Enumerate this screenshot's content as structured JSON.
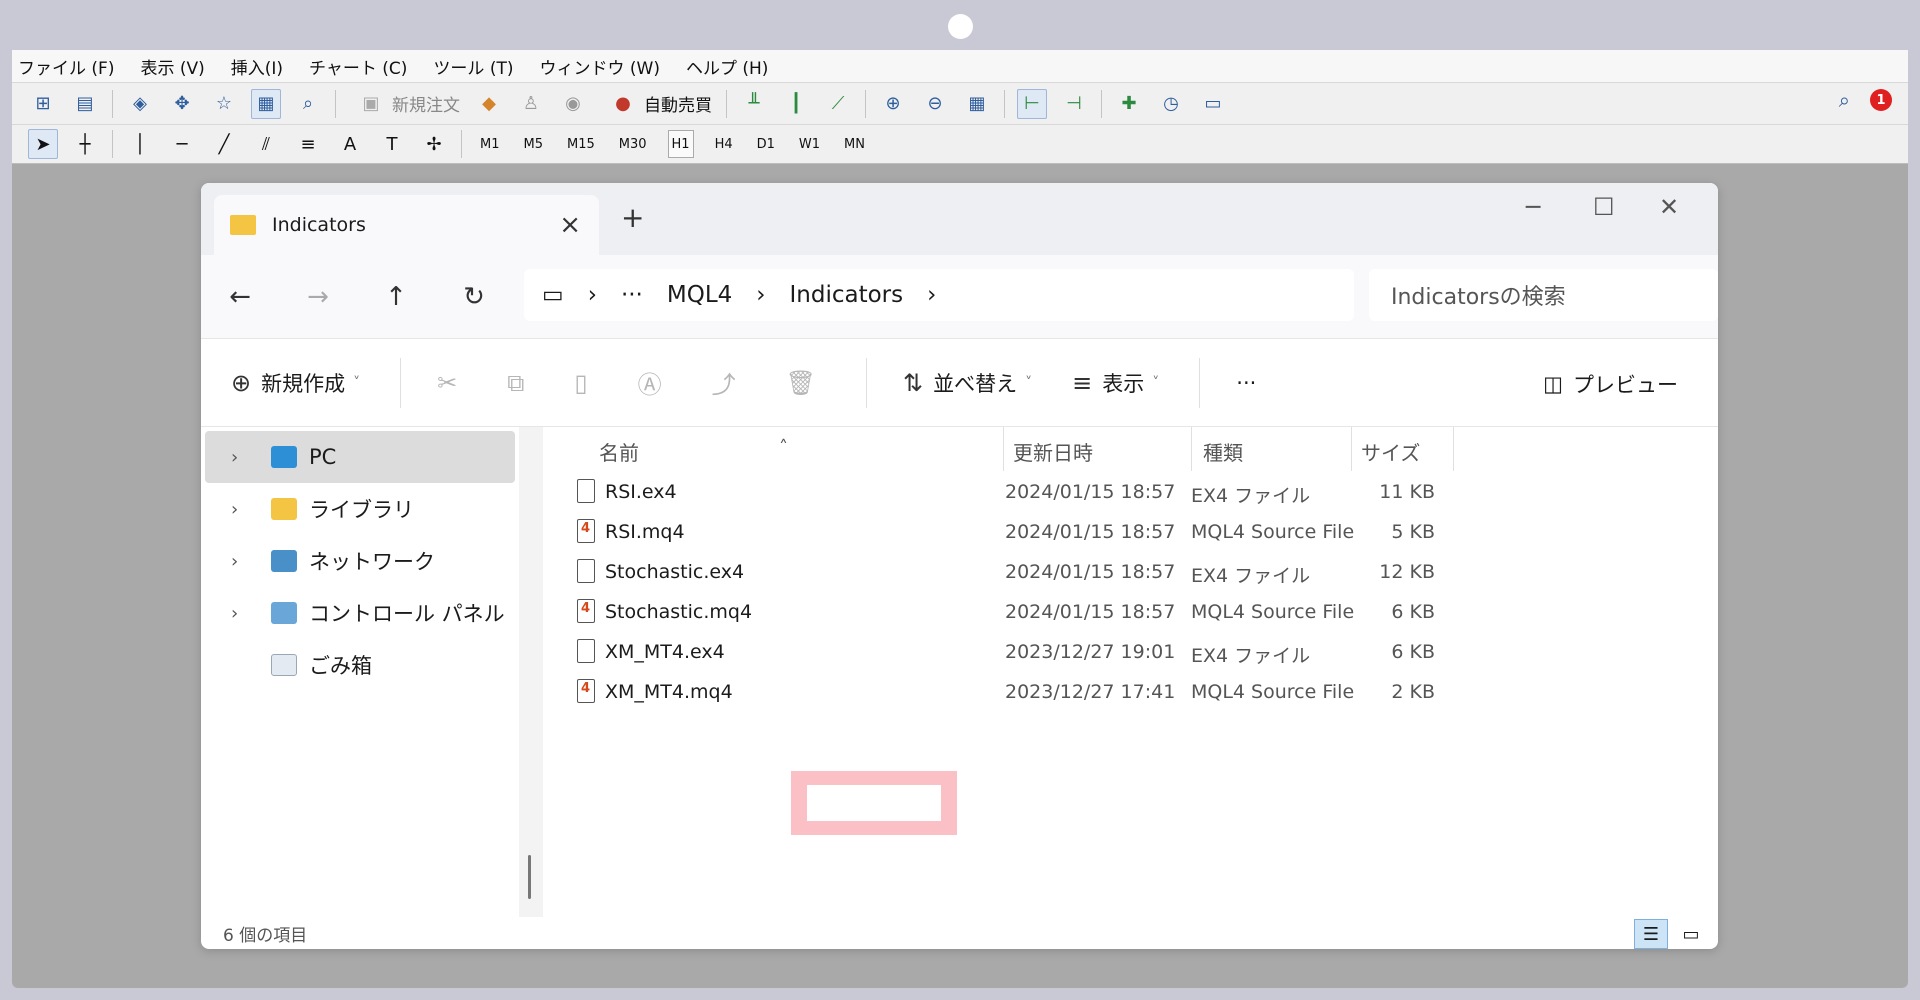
{
  "mt4": {
    "menu": [
      "ファイル (F)",
      "表示 (V)",
      "挿入(I)",
      "チャート (C)",
      "ツール (T)",
      "ウィンドウ (W)",
      "ヘルプ (H)"
    ],
    "new_order_label": "新規注文",
    "auto_trade_label": "自動売買",
    "timeframes": [
      "M1",
      "M5",
      "M15",
      "M30",
      "H1",
      "H4",
      "D1",
      "W1",
      "MN"
    ],
    "active_timeframe": "H1",
    "notification_count": "1"
  },
  "explorer": {
    "tab_title": "Indicators",
    "address": [
      "···",
      "MQL4",
      "Indicators"
    ],
    "search_placeholder": "Indicatorsの検索",
    "commands": {
      "new": "新規作成",
      "sort": "並べ替え",
      "view": "表示",
      "more": "···",
      "preview": "プレビュー"
    },
    "sidebar": [
      {
        "label": "PC",
        "expandable": true,
        "selected": true
      },
      {
        "label": "ライブラリ",
        "expandable": true
      },
      {
        "label": "ネットワーク",
        "expandable": true
      },
      {
        "label": "コントロール パネル",
        "expandable": true
      },
      {
        "label": "ごみ箱",
        "expandable": false
      }
    ],
    "columns": [
      "名前",
      "更新日時",
      "種類",
      "サイズ"
    ],
    "files": [
      {
        "name": "RSI.ex4",
        "date": "2024/01/15 18:57",
        "type": "EX4 ファイル",
        "size": "11 KB"
      },
      {
        "name": "RSI.mq4",
        "date": "2024/01/15 18:57",
        "type": "MQL4 Source File",
        "size": "5 KB"
      },
      {
        "name": "Stochastic.ex4",
        "date": "2024/01/15 18:57",
        "type": "EX4 ファイル",
        "size": "12 KB"
      },
      {
        "name": "Stochastic.mq4",
        "date": "2024/01/15 18:57",
        "type": "MQL4 Source File",
        "size": "6 KB"
      },
      {
        "name": "XM_MT4.ex4",
        "date": "2023/12/27 19:01",
        "type": "EX4 ファイル",
        "size": "6 KB"
      },
      {
        "name": "XM_MT4.mq4",
        "date": "2023/12/27 17:41",
        "type": "MQL4 Source File",
        "size": "2 KB"
      }
    ],
    "status": "6 個の項目",
    "colors": {
      "highlight": "#fbc0c6",
      "folder": "#f4c542"
    }
  }
}
